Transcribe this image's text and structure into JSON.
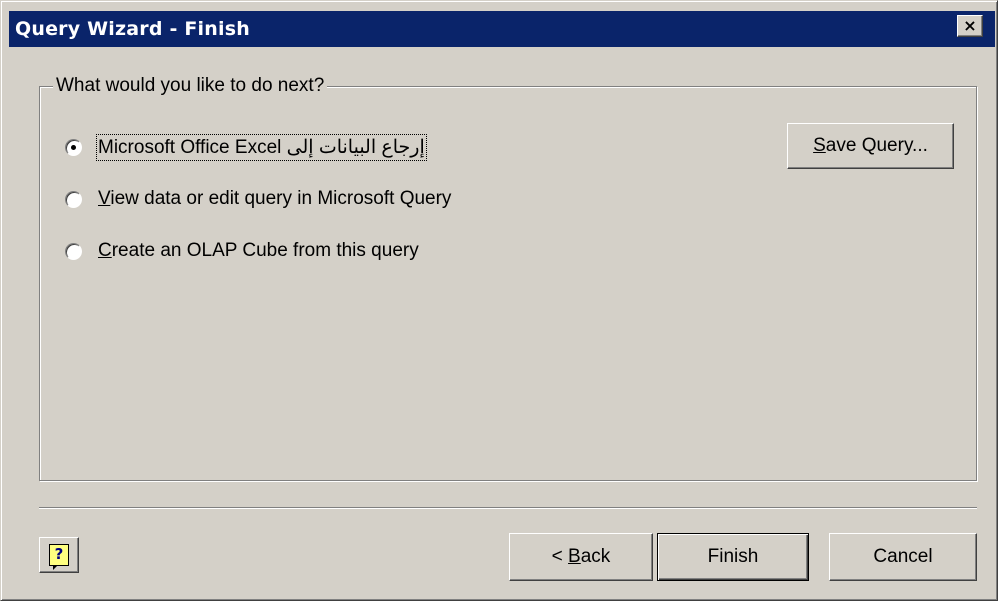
{
  "window": {
    "title": "Query Wizard - Finish",
    "close_glyph": "×",
    "title_bg": "#0a246a"
  },
  "group": {
    "legend": "What would you like to do next?"
  },
  "options": [
    {
      "label": "إرجاع البيانات إلى Microsoft Office Excel",
      "checked": true,
      "focused": true
    },
    {
      "label_prefix": "V",
      "label_rest": "iew data or edit query in Microsoft Query",
      "checked": false
    },
    {
      "label_prefix": "C",
      "label_rest": "reate an OLAP Cube from this query",
      "checked": false
    }
  ],
  "buttons": {
    "save_query_u": "S",
    "save_query_rest": "ave Query...",
    "back_pre": "< ",
    "back_u": "B",
    "back_rest": "ack",
    "finish": "Finish",
    "cancel": "Cancel",
    "help_glyph": "?"
  }
}
